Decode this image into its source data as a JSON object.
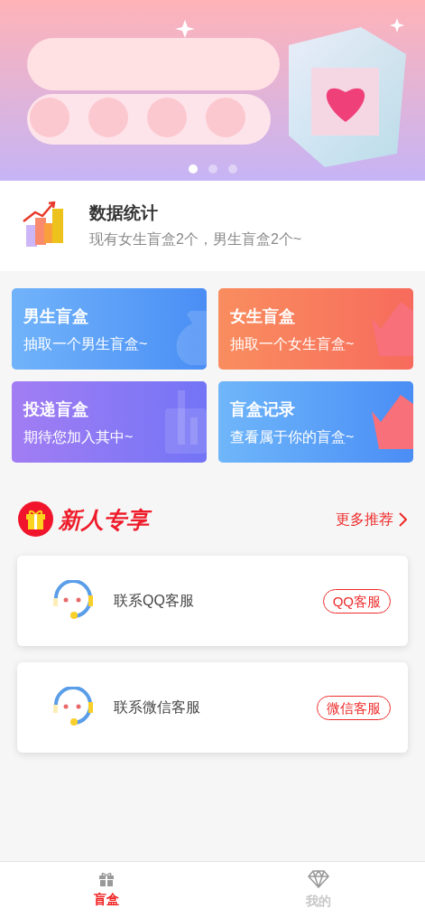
{
  "banner": {
    "slides": [
      {
        "selected": true
      },
      {
        "selected": false
      },
      {
        "selected": false
      }
    ]
  },
  "stats": {
    "title": "数据统计",
    "subtitle": "现有女生盲盒2个，男生盲盒2个~"
  },
  "tiles": [
    {
      "kind": "boy",
      "title": "男生盲盒",
      "subtitle": "抽取一个男生盲盒~"
    },
    {
      "kind": "girl",
      "title": "女生盲盒",
      "subtitle": "抽取一个女生盲盒~"
    },
    {
      "kind": "deliver",
      "title": "投递盲盒",
      "subtitle": "期待您加入其中~"
    },
    {
      "kind": "record",
      "title": "盲盒记录",
      "subtitle": "查看属于你的盲盒~"
    }
  ],
  "section": {
    "title": "新人专享",
    "more": "更多推荐"
  },
  "services": [
    {
      "label": "联系QQ客服",
      "button": "QQ客服"
    },
    {
      "label": "联系微信客服",
      "button": "微信客服"
    }
  ],
  "tabbar": [
    {
      "kind": "gift",
      "label": "盲盒",
      "selected": true
    },
    {
      "kind": "diamond",
      "label": "我的",
      "selected": false
    }
  ]
}
